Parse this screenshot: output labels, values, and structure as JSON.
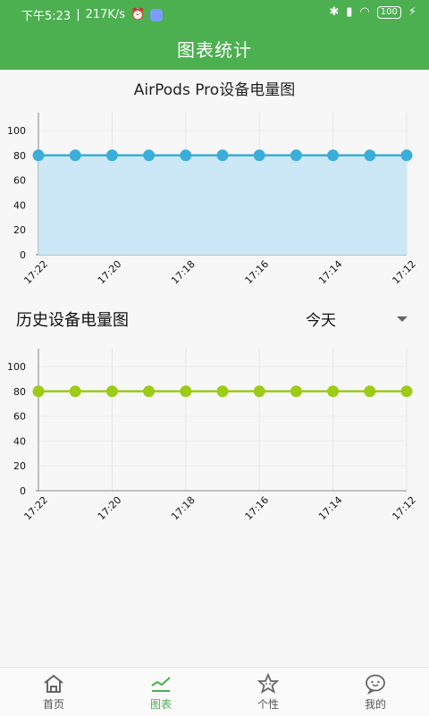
{
  "status_bar": {
    "time": "下午5:23",
    "speed": "217K/s",
    "battery": "100"
  },
  "header": {
    "title": "图表统计"
  },
  "chart1": {
    "title": "AirPods Pro设备电量图",
    "fill_color": "#c9e7f5",
    "line_color": "#3aaed8",
    "point_color": "#3aaed8"
  },
  "section": {
    "title": "历史设备电量图",
    "range_value": "今天"
  },
  "chart2": {
    "line_color": "#9ccc16",
    "point_color": "#9ccc16"
  },
  "chart_data": [
    {
      "type": "area",
      "title": "AirPods Pro设备电量图",
      "x": [
        "17:22",
        "17:21",
        "17:20",
        "17:19",
        "17:18",
        "17:17",
        "17:16",
        "17:15",
        "17:14",
        "17:13",
        "17:12"
      ],
      "x_tick_labels": [
        "17:22",
        "17:20",
        "17:18",
        "17:16",
        "17:14",
        "17:12"
      ],
      "values": [
        80,
        80,
        80,
        80,
        80,
        80,
        80,
        80,
        80,
        80,
        80
      ],
      "ylim": [
        0,
        100
      ],
      "yticks": [
        0,
        20,
        40,
        60,
        80,
        100
      ],
      "grid": true
    },
    {
      "type": "line",
      "title": "",
      "x": [
        "17:22",
        "17:21",
        "17:20",
        "17:19",
        "17:18",
        "17:17",
        "17:16",
        "17:15",
        "17:14",
        "17:13",
        "17:12"
      ],
      "x_tick_labels": [
        "17:22",
        "17:20",
        "17:18",
        "17:16",
        "17:14",
        "17:12"
      ],
      "values": [
        80,
        80,
        80,
        80,
        80,
        80,
        80,
        80,
        80,
        80,
        80
      ],
      "ylim": [
        0,
        100
      ],
      "yticks": [
        0,
        20,
        40,
        60,
        80,
        100
      ],
      "grid": true
    }
  ],
  "bottom_nav": {
    "items": [
      {
        "label": "首页",
        "icon": "home-icon"
      },
      {
        "label": "图表",
        "icon": "chart-icon"
      },
      {
        "label": "个性",
        "icon": "star-face-icon"
      },
      {
        "label": "我的",
        "icon": "chat-face-icon"
      }
    ]
  }
}
